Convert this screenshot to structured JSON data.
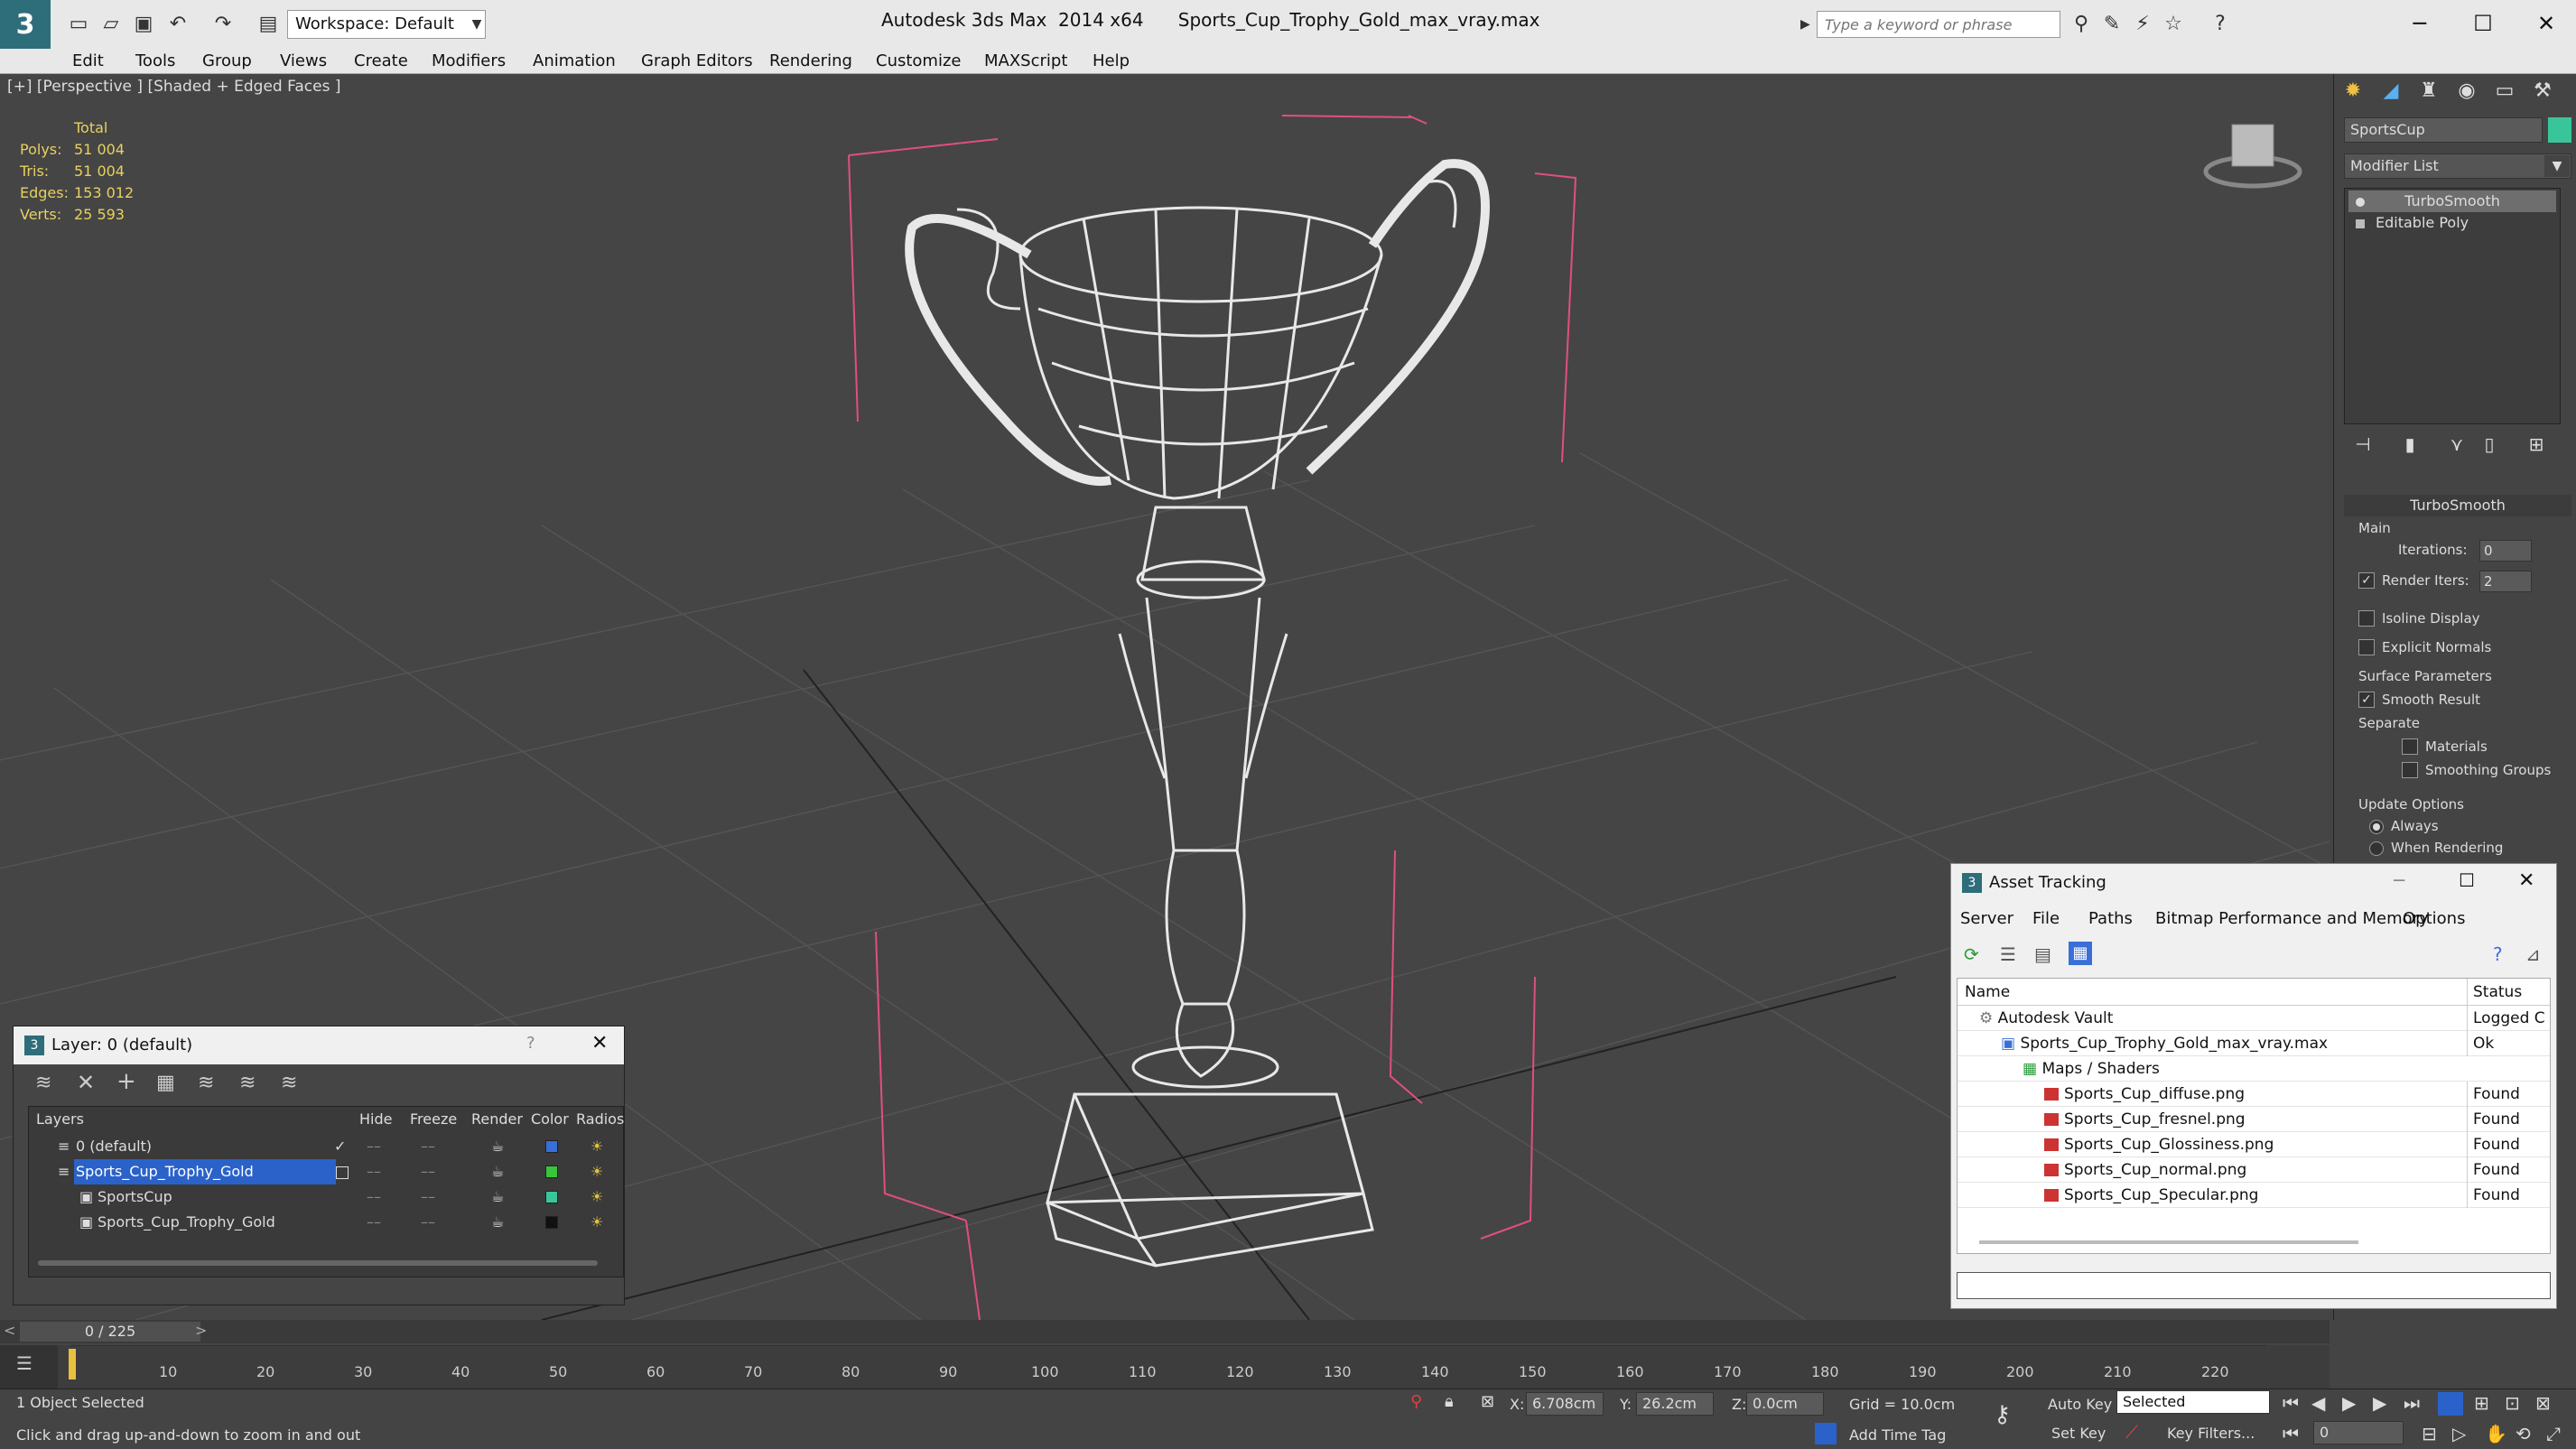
{
  "app": {
    "title": "Autodesk 3ds Max  2014 x64",
    "file": "Sports_Cup_Trophy_Gold_max_vray.max",
    "workspace": "Workspace: Default",
    "search_placeholder": "Type a keyword or phrase"
  },
  "menu": [
    "Edit",
    "Tools",
    "Group",
    "Views",
    "Create",
    "Modifiers",
    "Animation",
    "Graph Editors",
    "Rendering",
    "Customize",
    "MAXScript",
    "Help"
  ],
  "viewport": {
    "label": "[+] [Perspective ] [Shaded + Edged Faces ]",
    "stats": {
      "header": "Total",
      "rows": [
        {
          "label": "Polys:",
          "value": "51 004"
        },
        {
          "label": "Tris:",
          "value": "51 004"
        },
        {
          "label": "Edges:",
          "value": "153 012"
        },
        {
          "label": "Verts:",
          "value": "25 593"
        }
      ]
    }
  },
  "command_panel": {
    "object_name": "SportsCup",
    "modifier_list": "Modifier List",
    "stack": [
      "TurboSmooth",
      "Editable Poly"
    ],
    "rollout_title": "TurboSmooth",
    "main_label": "Main",
    "iterations_label": "Iterations:",
    "iterations_value": "0",
    "render_iters_label": "Render Iters:",
    "render_iters_value": "2",
    "isoline_label": "Isoline Display",
    "explicit_normals_label": "Explicit Normals",
    "surface_params_label": "Surface Parameters",
    "smooth_result_label": "Smooth Result",
    "separate_label": "Separate",
    "materials_label": "Materials",
    "smoothing_groups_label": "Smoothing Groups",
    "update_options_label": "Update Options",
    "always_label": "Always",
    "when_rendering_label": "When Rendering"
  },
  "layer_dialog": {
    "title": "Layer: 0 (default)",
    "help": "?",
    "columns": [
      "Layers",
      "Hide",
      "Freeze",
      "Render",
      "Color",
      "Radios"
    ],
    "rows": [
      {
        "name": "0 (default)",
        "color": "#3a6ed8",
        "indent": 1
      },
      {
        "name": "Sports_Cup_Trophy_Gold",
        "color": "#39c53a",
        "indent": 1
      },
      {
        "name": "SportsCup",
        "color": "#39c59a",
        "indent": 2
      },
      {
        "name": "Sports_Cup_Trophy_Gold",
        "color": "#111111",
        "indent": 2
      }
    ]
  },
  "asset_tracking": {
    "title": "Asset Tracking",
    "menu": [
      "Server",
      "File",
      "Paths",
      "Bitmap Performance and Memory",
      "Options"
    ],
    "columns": [
      "Name",
      "Status"
    ],
    "rows": [
      {
        "name": "Autodesk Vault",
        "status": "Logged C",
        "indent": 0
      },
      {
        "name": "Sports_Cup_Trophy_Gold_max_vray.max",
        "status": "Ok",
        "indent": 1
      },
      {
        "name": "Maps / Shaders",
        "status": "",
        "indent": 2
      },
      {
        "name": "Sports_Cup_diffuse.png",
        "status": "Found",
        "indent": 3
      },
      {
        "name": "Sports_Cup_fresnel.png",
        "status": "Found",
        "indent": 3
      },
      {
        "name": "Sports_Cup_Glossiness.png",
        "status": "Found",
        "indent": 3
      },
      {
        "name": "Sports_Cup_normal.png",
        "status": "Found",
        "indent": 3
      },
      {
        "name": "Sports_Cup_Specular.png",
        "status": "Found",
        "indent": 3
      }
    ]
  },
  "timeline": {
    "counter": "0 / 225",
    "ticks": [
      "10",
      "20",
      "30",
      "40",
      "50",
      "60",
      "70",
      "80",
      "90",
      "100",
      "110",
      "120",
      "130",
      "140",
      "150",
      "160",
      "170",
      "180",
      "190",
      "200",
      "210",
      "220"
    ]
  },
  "status": {
    "selection": "1 Object Selected",
    "prompt": "Click and drag up-and-down to zoom in and out",
    "x_label": "X:",
    "x_value": "6.708cm",
    "y_label": "Y:",
    "y_value": "26.2cm",
    "z_label": "Z:",
    "z_value": "0.0cm",
    "grid": "Grid = 10.0cm",
    "add_time_tag": "Add Time Tag",
    "auto_key": "Auto Key",
    "set_key": "Set Key",
    "selected_value": "Selected",
    "key_filters": "Key Filters...",
    "frame_value": "0"
  }
}
